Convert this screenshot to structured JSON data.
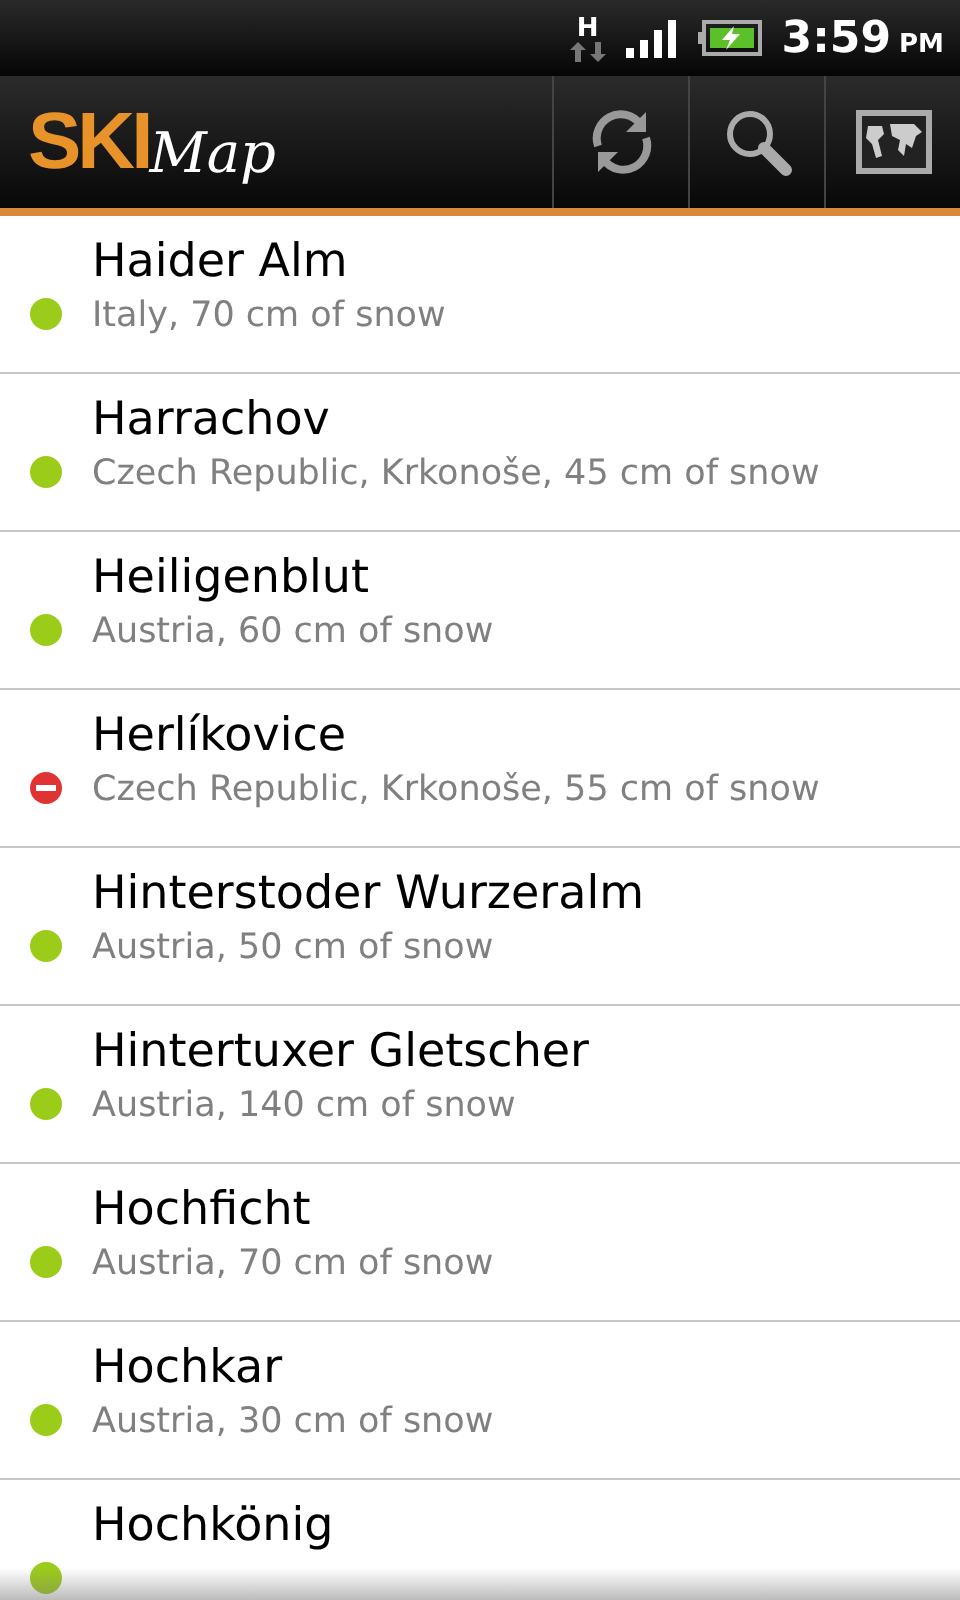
{
  "status_bar": {
    "network": "H",
    "time": "3:59",
    "meridiem": "PM"
  },
  "app_bar": {
    "logo_bold": "SKI",
    "logo_script": "Map"
  },
  "resorts": [
    {
      "name": "Haider Alm",
      "details": "Italy, 70 cm of snow",
      "kind": "open"
    },
    {
      "name": "Harrachov",
      "details": "Czech Republic, Krkonoše, 45 cm of snow",
      "kind": "open"
    },
    {
      "name": "Heiligenblut",
      "details": "Austria, 60 cm of snow",
      "kind": "open"
    },
    {
      "name": "Herlíkovice",
      "details": "Czech Republic, Krkonoše, 55 cm of snow",
      "kind": "closed"
    },
    {
      "name": "Hinterstoder Wurzeralm",
      "details": "Austria, 50 cm of snow",
      "kind": "open"
    },
    {
      "name": "Hintertuxer Gletscher",
      "details": "Austria, 140 cm of snow",
      "kind": "open"
    },
    {
      "name": "Hochficht",
      "details": "Austria, 70 cm of snow",
      "kind": "open"
    },
    {
      "name": "Hochkar",
      "details": "Austria, 30 cm of snow",
      "kind": "open"
    },
    {
      "name": "Hochkönig",
      "kind": "open"
    }
  ]
}
